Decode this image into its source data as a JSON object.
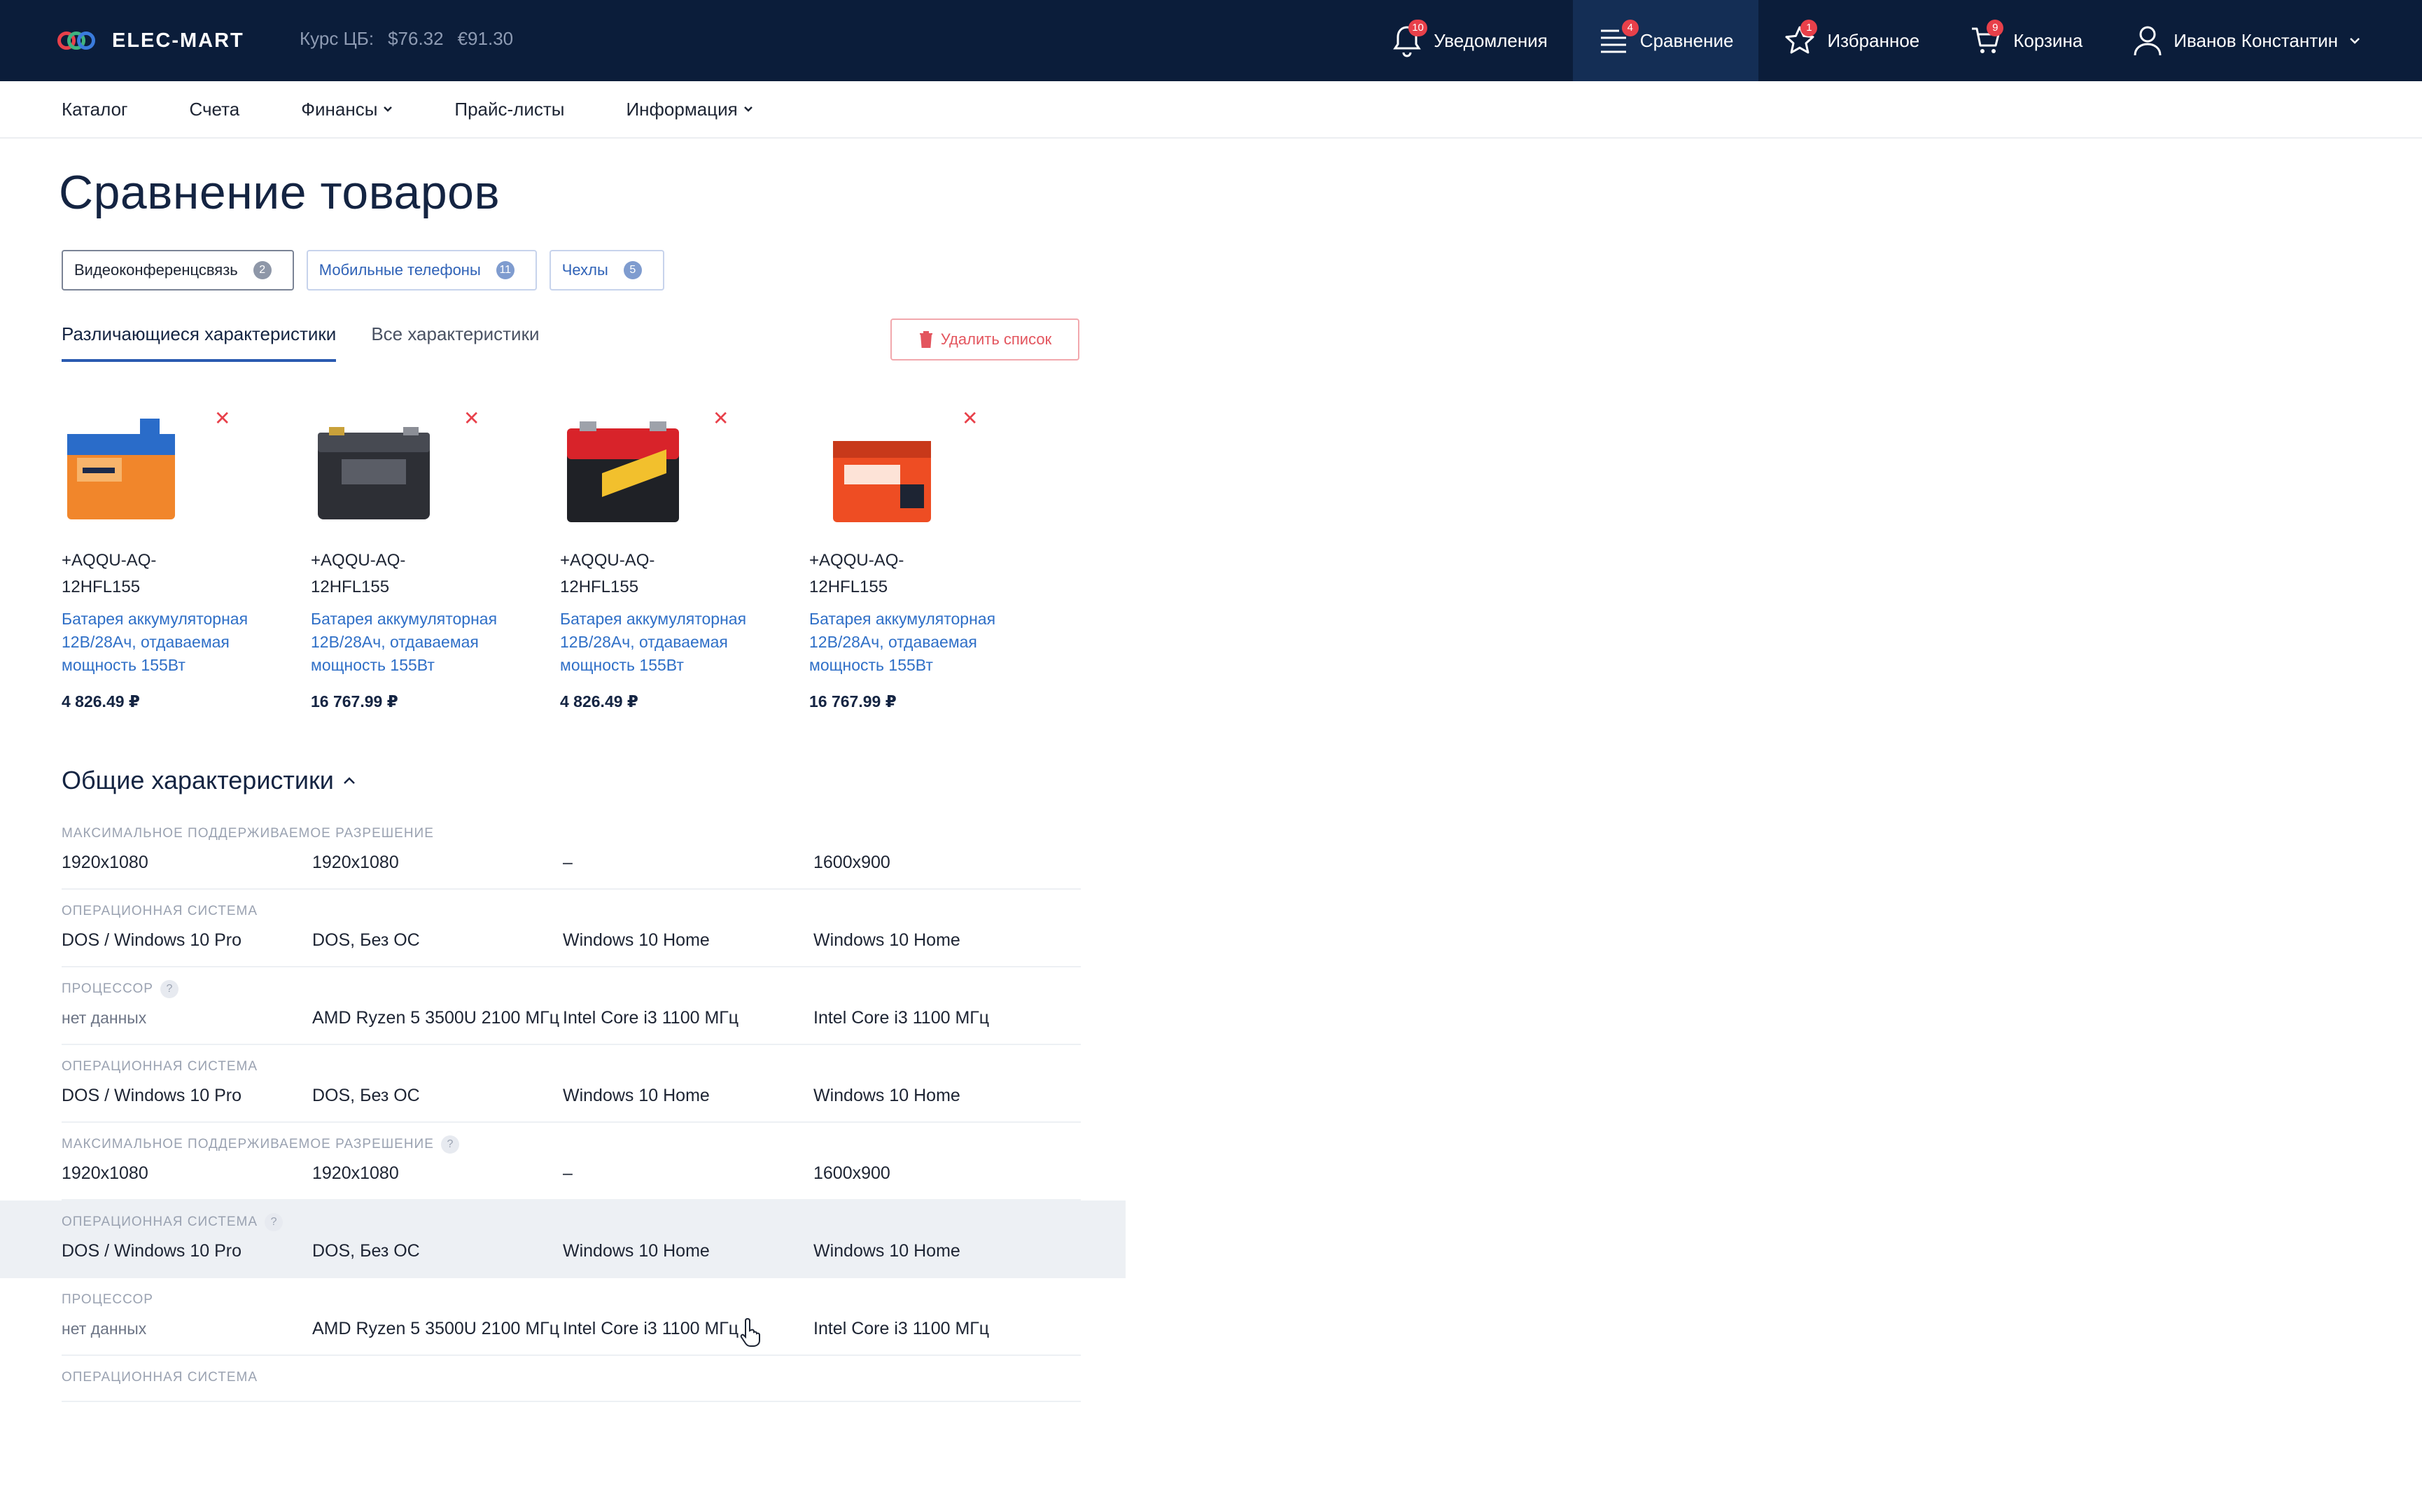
{
  "header": {
    "logo_text": "ELEC-MART",
    "rate_label": "Курс ЦБ:",
    "rate_usd": "$76.32",
    "rate_eur": "€91.30",
    "nav": [
      {
        "label": "Уведомления",
        "badge": "10",
        "icon": "bell-icon"
      },
      {
        "label": "Сравнение",
        "badge": "4",
        "icon": "compare-list-icon",
        "active": true
      },
      {
        "label": "Избранное",
        "badge": "1",
        "icon": "star-icon"
      },
      {
        "label": "Корзина",
        "badge": "9",
        "icon": "cart-icon"
      },
      {
        "label": "Иванов Константин",
        "icon": "user-icon"
      }
    ]
  },
  "subnav": [
    {
      "label": "Каталог"
    },
    {
      "label": "Счета"
    },
    {
      "label": "Финансы",
      "dropdown": true
    },
    {
      "label": "Прайс-листы"
    },
    {
      "label": "Информация",
      "dropdown": true
    }
  ],
  "page_title": "Сравнение товаров",
  "chips": [
    {
      "label": "Видеоконференцсвязь",
      "count": "2"
    },
    {
      "label": "Мобильные телефоны",
      "count": "11"
    },
    {
      "label": "Чехлы",
      "count": "5"
    }
  ],
  "tabs": [
    {
      "label": "Различающиеся характеристики"
    },
    {
      "label": "Все характеристики"
    }
  ],
  "delete_label": "Удалить список",
  "products": [
    {
      "sku": "+AQQU-AQ-12HFL155",
      "name": "Батарея аккумуляторная 12В/28Ач, отдаваемая мощность 155Вт",
      "price": "4 826.49 ₽"
    },
    {
      "sku": "+AQQU-AQ-12HFL155",
      "name": "Батарея аккумуляторная 12В/28Ач, отдаваемая мощность 155Вт",
      "price": "16 767.99 ₽"
    },
    {
      "sku": "+AQQU-AQ-12HFL155",
      "name": "Батарея аккумуляторная 12В/28Ач, отдаваемая мощность 155Вт",
      "price": "4 826.49 ₽"
    },
    {
      "sku": "+AQQU-AQ-12HFL155",
      "name": "Батарея аккумуляторная 12В/28Ач, отдаваемая мощность 155Вт",
      "price": "16 767.99 ₽"
    }
  ],
  "section_title": "Общие характеристики",
  "specs": [
    {
      "label": "Максимальное поддерживаемое разрешение",
      "values": [
        "1920x1080",
        "1920x1080",
        "–",
        "1600x900"
      ]
    },
    {
      "label": "Операционная система",
      "values": [
        "DOS / Windows 10 Pro",
        "DOS, Без ОС",
        "Windows 10 Home",
        "Windows 10 Home"
      ]
    },
    {
      "label": "Процессор",
      "help": "?",
      "values": [
        "нет данных",
        "AMD Ryzen 5 3500U 2100 МГц",
        "Intel Core i3 1100 МГц",
        "Intel Core i3 1100 МГц"
      ]
    },
    {
      "label": "Операционная система",
      "values": [
        "DOS / Windows 10 Pro",
        "DOS, Без ОС",
        "Windows 10 Home",
        "Windows 10 Home"
      ]
    },
    {
      "label": "Максимальное поддерживаемое разрешение",
      "help": "?",
      "values": [
        "1920x1080",
        "1920x1080",
        "–",
        "1600x900"
      ]
    },
    {
      "label": "Операционная система",
      "help": "?",
      "values": [
        "DOS / Windows 10 Pro",
        "DOS, Без ОС",
        "Windows 10 Home",
        "Windows 10 Home"
      ],
      "highlighted": true
    },
    {
      "label": "Процессор",
      "values": [
        "нет данных",
        "AMD Ryzen 5 3500U 2100 МГц",
        "Intel Core i3 1100 МГц",
        "Intel Core i3 1100 МГц"
      ]
    },
    {
      "label": "Операционная система",
      "values": []
    }
  ],
  "colors": {
    "topbar": "#0b1d3a",
    "accent": "#2a5ab0",
    "link": "#2f6fc7",
    "danger": "#e8404a"
  }
}
